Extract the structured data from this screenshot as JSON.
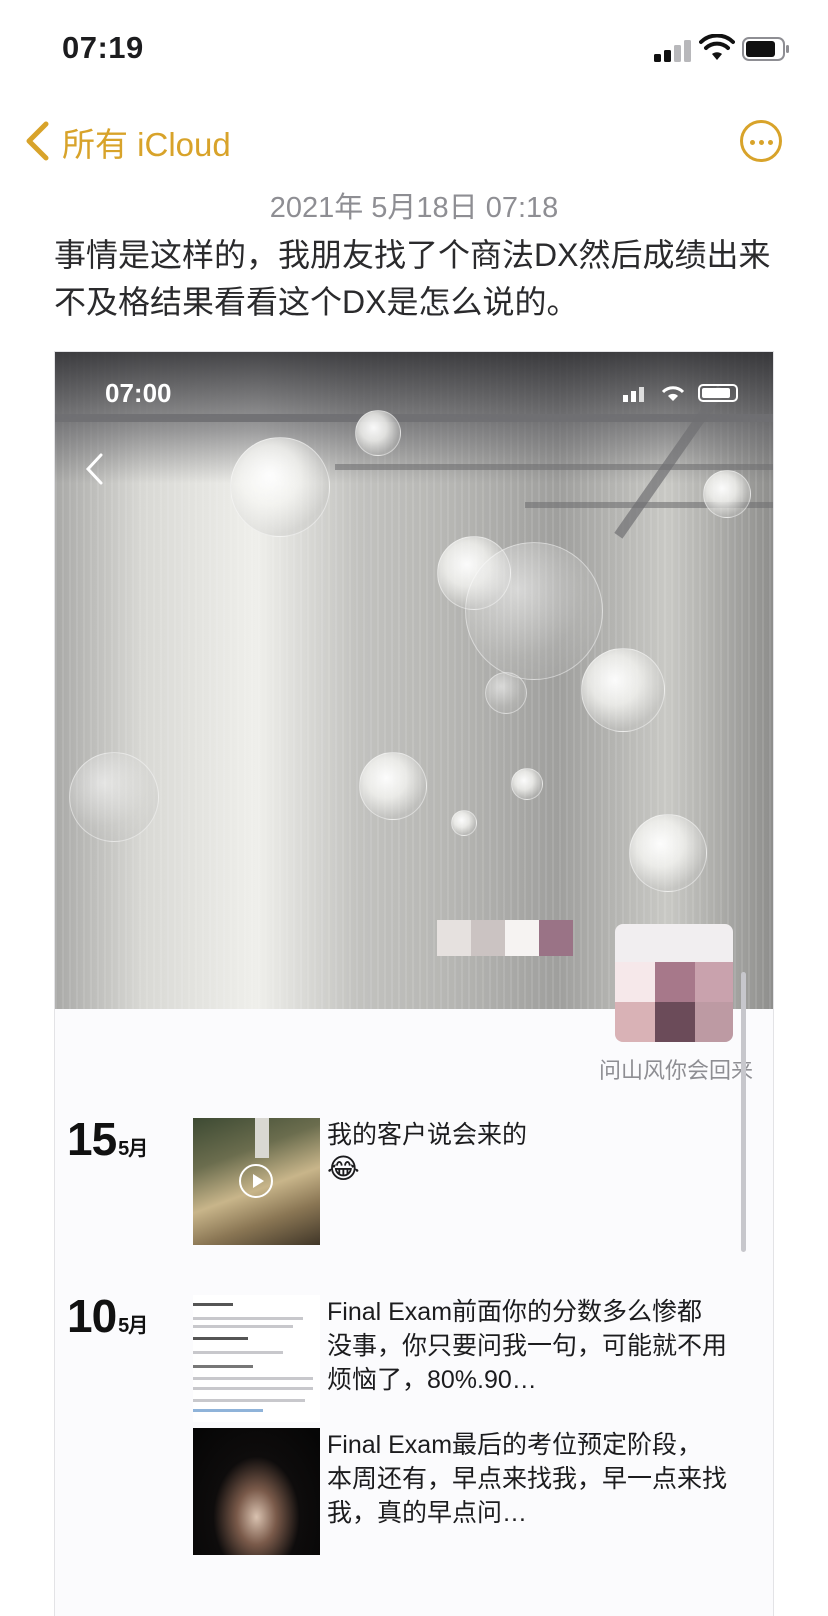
{
  "status_bar": {
    "time": "07:19"
  },
  "nav": {
    "back_label": "所有 iCloud"
  },
  "note": {
    "date": "2021年 5月18日 07:18",
    "body": "事情是这样的，我朋友找了个商法DX然后成绩出来不及格结果看看这个DX是怎么说的。"
  },
  "embedded_screenshot": {
    "status_time": "07:00",
    "signature": "问山风你会回来",
    "posts": [
      {
        "day": "15",
        "month": "5月",
        "text": "我的客户说会来的",
        "emoji": "😂"
      },
      {
        "day": "10",
        "month": "5月",
        "text": "Final Exam前面你的分数多么惨都没事，你只要问我一句，可能就不用烦恼了，80%.90…"
      },
      {
        "day": "",
        "month": "",
        "text": "Final Exam最后的考位预定阶段，本周还有，早点来找我，早一点来找我，真的早点问…"
      }
    ]
  },
  "colors": {
    "accent": "#d8a32a",
    "secondary_text": "#8e8e93"
  },
  "icons": [
    "signal-icon",
    "wifi-icon",
    "battery-icon",
    "chevron-left-icon",
    "more-icon",
    "play-icon"
  ]
}
